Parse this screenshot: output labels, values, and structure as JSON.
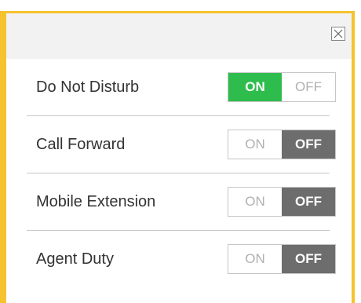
{
  "header": {
    "close_icon": "close-icon"
  },
  "colors": {
    "accent_border": "#f6c22e",
    "on_active": "#2ebd4d",
    "off_active": "#6d6d6d"
  },
  "settings": [
    {
      "label": "Do Not Disturb",
      "on_label": "ON",
      "off_label": "OFF",
      "state": "on"
    },
    {
      "label": "Call Forward",
      "on_label": "ON",
      "off_label": "OFF",
      "state": "off"
    },
    {
      "label": "Mobile Extension",
      "on_label": "ON",
      "off_label": "OFF",
      "state": "off"
    },
    {
      "label": "Agent Duty",
      "on_label": "ON",
      "off_label": "OFF",
      "state": "off"
    }
  ]
}
